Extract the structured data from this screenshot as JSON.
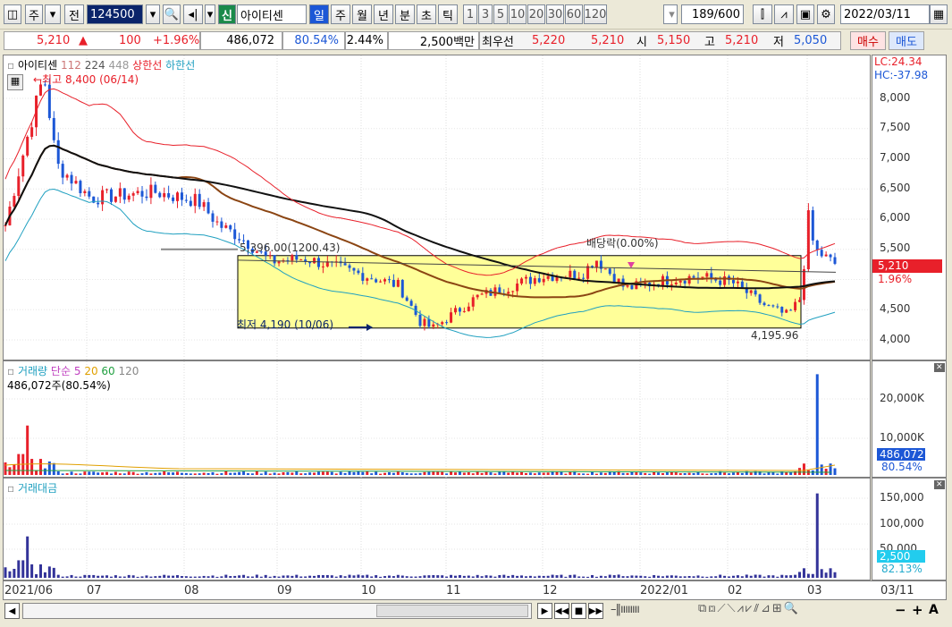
{
  "toolbar": {
    "period_type": "주",
    "prev_label": "전",
    "code": "124500",
    "credit_badge": "신",
    "stock_name": "아이티센",
    "periods": [
      "일",
      "주",
      "월",
      "년",
      "분",
      "초",
      "틱"
    ],
    "active_period": "일",
    "intervals": [
      "1",
      "3",
      "5",
      "10",
      "20",
      "30",
      "60",
      "120"
    ],
    "count": "189",
    "count_max": "/600",
    "date": "2022/03/11"
  },
  "quote": {
    "price": "5,210",
    "change_arrow": "▲",
    "change": "100",
    "change_pct": "+1.96%",
    "volume": "486,072",
    "vol_ratio": "80.54%",
    "turnover_pct": "2.44%",
    "amount": "2,500백만",
    "best_label": "최우선",
    "best_ask": "5,220",
    "best_bid": "5,210",
    "open_label": "시",
    "open": "5,150",
    "high_label": "고",
    "high": "5,210",
    "low_label": "저",
    "low": "5,050",
    "buy_label": "매수",
    "sell_label": "매도"
  },
  "price_pane": {
    "title": "아이티센",
    "ma1": "112",
    "ma2": "224",
    "ma3": "448",
    "upper_limit": "상한선",
    "lower_limit": "하한선",
    "high_note": "←최고 8,400 (06/14)",
    "low_note": "최저 4,190 (10/06)",
    "box_top_label": "5,396.00(1200.43)",
    "box_bottom_label": "4,195.96",
    "dividend_label": "배당락(0.00%)",
    "lc": "LC:24.34",
    "hc": "HC:-37.98",
    "last_price": "5,210",
    "last_pct": "1.96%",
    "yticks": [
      "8,000",
      "7,500",
      "7,000",
      "6,500",
      "6,000",
      "5,500",
      "4,500",
      "4,000"
    ]
  },
  "volume_pane": {
    "title": "거래량",
    "ma_label": "단순",
    "mas": [
      "5",
      "20",
      "60",
      "120"
    ],
    "current": "486,072주(80.54%)",
    "yticks": [
      "20,000K",
      "10,000K"
    ],
    "last_value": "486,072",
    "last_pct": "80.54%"
  },
  "amount_pane": {
    "title": "거래대금",
    "yticks": [
      "150,000",
      "100,000",
      "50,000"
    ],
    "last_value": "2,500",
    "last_pct": "82.13%"
  },
  "xaxis": [
    "2021/06",
    "07",
    "08",
    "09",
    "10",
    "11",
    "12",
    "2022/01",
    "02",
    "03"
  ],
  "xaxis_right": "03/11",
  "colors": {
    "up": "#e8202a",
    "down": "#1c57d6",
    "box_fill": "#ffff99",
    "accent": "#0a246a"
  }
}
